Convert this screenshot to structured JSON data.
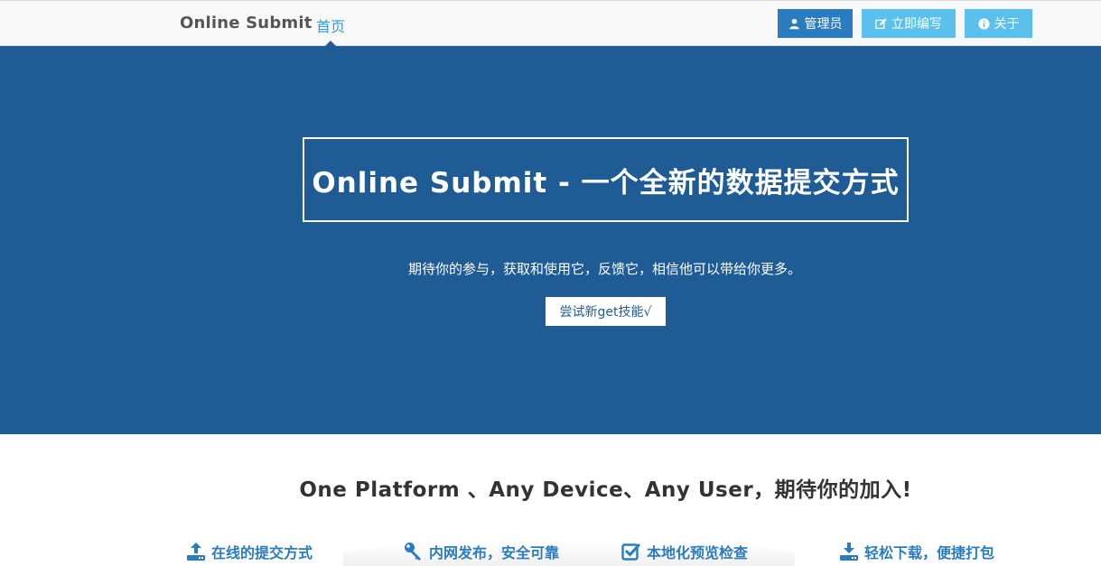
{
  "navbar": {
    "brand": "Online Submit",
    "home": "首页",
    "buttons": {
      "admin": "管理员",
      "write": "立即编写",
      "about": "关于"
    }
  },
  "hero": {
    "title": "Online Submit - 一个全新的数据提交方式",
    "subtitle": "期待你的参与，获取和使用它，反馈它，相信他可以带给你更多。",
    "cta": "尝试新get技能√"
  },
  "tagline": "One Platform 、Any Device、Any User，期待你的加入!",
  "features": [
    {
      "label": "在线的提交方式",
      "icon": "upload-icon"
    },
    {
      "label": "内网发布，安全可靠",
      "icon": "key-icon"
    },
    {
      "label": "本地化预览检查",
      "icon": "check-square-icon"
    },
    {
      "label": "轻松下载，便捷打包",
      "icon": "download-icon"
    }
  ],
  "colors": {
    "primary": "#1f5c96",
    "accent": "#2a9fd6",
    "button_light": "#5bc0eb",
    "button_dark": "#2a7cbf"
  }
}
